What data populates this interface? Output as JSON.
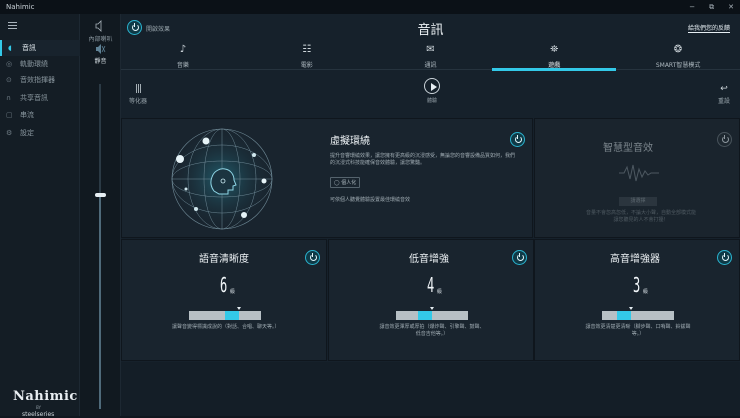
{
  "window": {
    "title": "Nahimic",
    "minimize": "−",
    "maximize": "⧉",
    "close": "✕"
  },
  "nav": {
    "items": [
      {
        "label": "音訊",
        "icon": "audio-icon",
        "glyph": "◖"
      },
      {
        "label": "軌動環繞",
        "icon": "surround-icon",
        "glyph": "◎"
      },
      {
        "label": "音效指揮器",
        "icon": "sound-tracker-icon",
        "glyph": "⊙"
      },
      {
        "label": "共享音訊",
        "icon": "headset-icon",
        "glyph": "∩"
      },
      {
        "label": "串流",
        "icon": "stream-icon",
        "glyph": "▢"
      },
      {
        "label": "設定",
        "icon": "settings-icon",
        "glyph": "⚙"
      }
    ]
  },
  "devices": {
    "speaker_label": "內部喇叭",
    "mute_label": "靜音",
    "volume_level": 0.66
  },
  "header": {
    "sound_effects_label": "開啟效果",
    "title": "音訊",
    "feedback_link": "給我們您的反饋"
  },
  "tabs": [
    {
      "label": "音樂",
      "icon": "music-icon",
      "glyph": "♪"
    },
    {
      "label": "電影",
      "icon": "movie-icon",
      "glyph": "☷"
    },
    {
      "label": "通訊",
      "icon": "chat-icon",
      "glyph": "✉"
    },
    {
      "label": "遊戲",
      "icon": "gamepad-icon",
      "glyph": "⛯"
    },
    {
      "label": "SMART智慧模式",
      "icon": "smart-mode-icon",
      "glyph": "❂"
    }
  ],
  "active_tab": 3,
  "toolbar": {
    "equalizer_label": "等化器",
    "demo_label": "體驗",
    "reset_label": "重設"
  },
  "virtual_surround": {
    "title": "虛擬環繞",
    "description": "提升音響環繞效果，讓您擁有更高級的沉浸感受，無論您的音響設備品質如何，我們的沉浸式科技能確保音效體驗，讓您驚豔。",
    "headphones_chip": "個人化",
    "footer_text": "可依個人聽覺體驗設置最佳環繞音效",
    "enabled": true
  },
  "smart_volume": {
    "title": "智慧型音效",
    "button_label": "請選擇",
    "description": "音量不會忽高忽低，不論大小聲，自動全部模式能讓您聽見的人不會打擾！",
    "enabled": false
  },
  "voice_clarity": {
    "title": "語音清晰度",
    "value": "6",
    "unit": "級",
    "level": 0.6,
    "description": "讓聲音變得標識成說的（對話、合唱、聊天等。）",
    "enabled": true
  },
  "bass_boost": {
    "title": "低音增強",
    "value": "4",
    "unit": "級",
    "level": 0.4,
    "description": "讓音效更渾厚或厚拍（爆炸聲、引擎聲、鼓聲、低音吉他等。）",
    "enabled": true
  },
  "treble_boost": {
    "title": "高音增強器",
    "value": "3",
    "unit": "級",
    "level": 0.3,
    "description": "讓音效更清楚更清晰（腳步聲、口哨聲、鈴鈸聲等。）",
    "enabled": true
  },
  "branding": {
    "logo": "Nahimic",
    "by": "BY",
    "partner": "steelseries"
  },
  "colors": {
    "accent": "#33c9e8",
    "background": "#10171f",
    "panel": "#19242e"
  }
}
